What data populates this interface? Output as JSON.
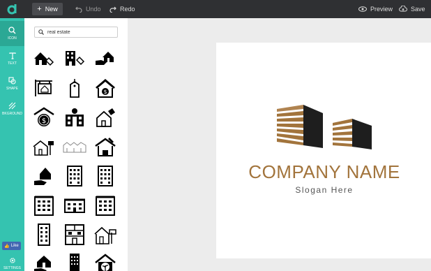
{
  "toolbar": {
    "new_label": "New",
    "undo_label": "Undo",
    "redo_label": "Redo",
    "preview_label": "Preview",
    "save_label": "Save"
  },
  "sidebar": {
    "items": [
      {
        "label": "ICON",
        "icon": "search-icon"
      },
      {
        "label": "TEXT",
        "icon": "text-icon"
      },
      {
        "label": "SHAPE",
        "icon": "shape-icon"
      },
      {
        "label": "BKGROUND",
        "icon": "background-icon"
      }
    ],
    "like_label": "Like",
    "settings_label": "SETTINGS"
  },
  "search": {
    "value": "real estate"
  },
  "canvas": {
    "company_name": "COMPANY NAME",
    "slogan": "Slogan Here"
  },
  "colors": {
    "accent": "#35c3b0",
    "topbar": "#2f3033",
    "brand_gold": "#a2743c",
    "facebook": "#4267b2"
  }
}
